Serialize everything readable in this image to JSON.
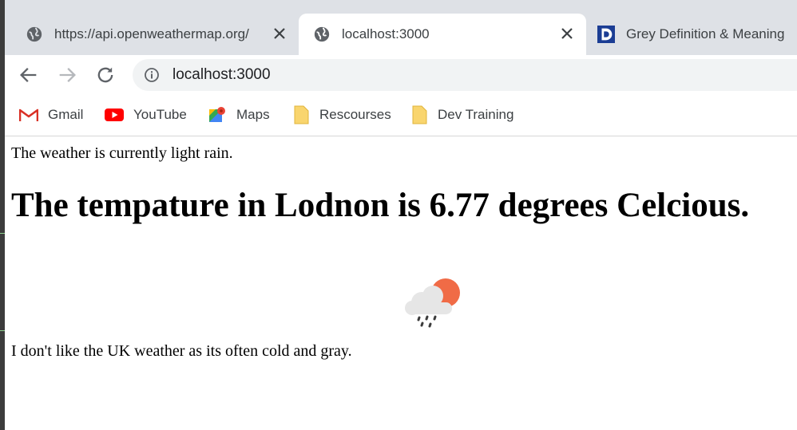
{
  "browser": {
    "tabs": [
      {
        "title": "https://api.openweathermap.org/",
        "favicon": "globe-icon",
        "active": false
      },
      {
        "title": "localhost:3000",
        "favicon": "globe-icon",
        "active": true
      },
      {
        "title": "Grey Definition & Meaning",
        "favicon": "dictionary-logo-icon",
        "active": false
      }
    ],
    "address": "localhost:3000",
    "bookmarks": [
      {
        "label": "Gmail",
        "icon": "gmail-icon"
      },
      {
        "label": "YouTube",
        "icon": "youtube-icon"
      },
      {
        "label": "Maps",
        "icon": "maps-icon"
      },
      {
        "label": "Rescourses",
        "icon": "folder-icon"
      },
      {
        "label": "Dev Training",
        "icon": "folder-icon"
      }
    ]
  },
  "page": {
    "description": "The weather is currently light rain.",
    "headline": "The tempature in Lodnon is 6.77 degrees Celcious.",
    "weather_icon": "light-rain-day-icon",
    "note": "I don't like the UK weather as its often cold and gray."
  },
  "colors": {
    "tab_strip": "#dee1e6",
    "omnibox": "#f1f3f4",
    "sun": "#f06b46",
    "cloud": "#e8e8e8"
  }
}
